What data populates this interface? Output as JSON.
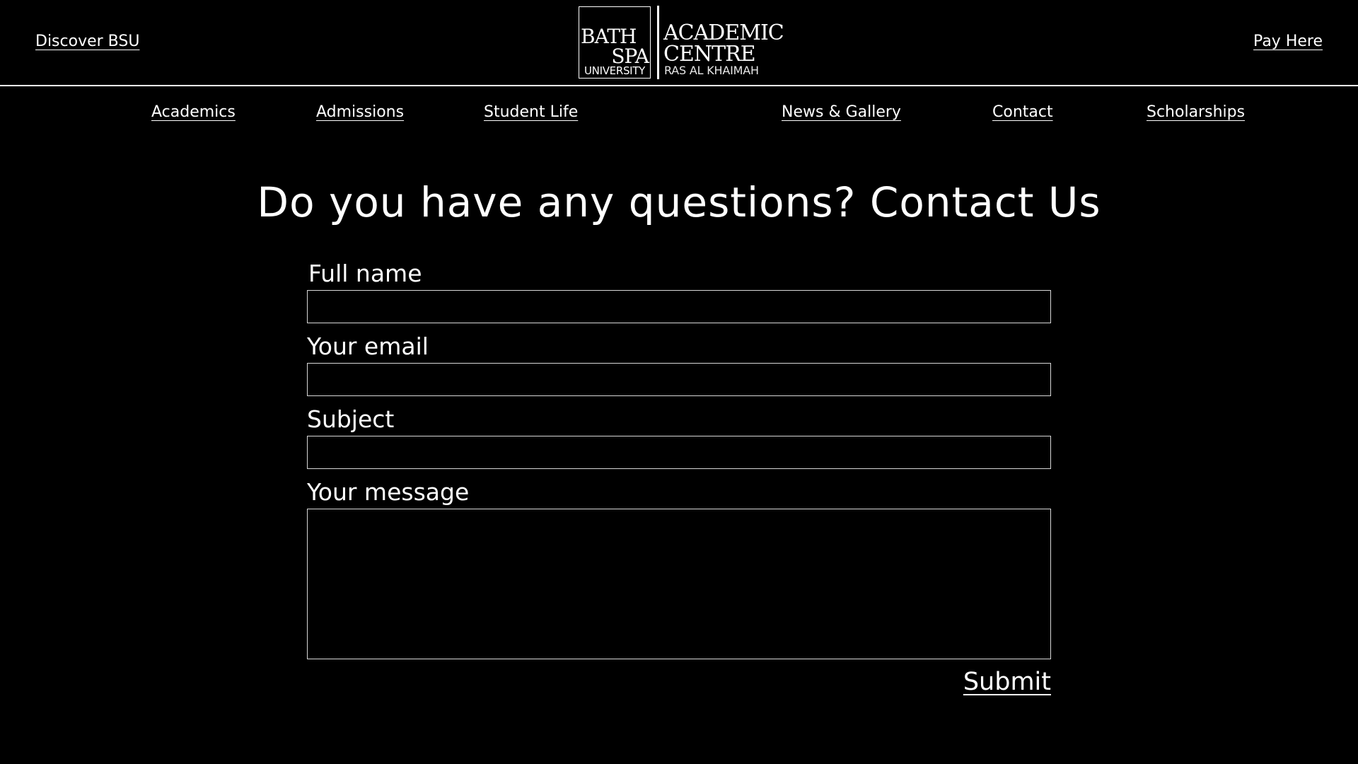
{
  "header": {
    "discover_label": "Discover BSU",
    "pay_label": "Pay Here",
    "logo": {
      "line1": "BATH",
      "line2": "SPA",
      "line3": "UNIVERSITY",
      "title1": "ACADEMIC",
      "title2": "CENTRE",
      "subtitle": "RAS AL KHAIMAH"
    }
  },
  "nav": {
    "items": [
      {
        "label": "Academics"
      },
      {
        "label": "Admissions"
      },
      {
        "label": "Student Life"
      },
      {
        "label": "News & Gallery"
      },
      {
        "label": "Contact"
      },
      {
        "label": "Scholarships"
      }
    ]
  },
  "main": {
    "heading": "Do you have any questions? Contact Us",
    "form": {
      "full_name": {
        "label": "Full name",
        "value": ""
      },
      "email": {
        "label": "Your email",
        "value": ""
      },
      "subject": {
        "label": "Subject",
        "value": ""
      },
      "message": {
        "label": "Your message",
        "value": ""
      },
      "submit_label": "Submit"
    }
  },
  "colors": {
    "background": "#000000",
    "foreground": "#ffffff",
    "field_border": "#d8d8d8"
  }
}
